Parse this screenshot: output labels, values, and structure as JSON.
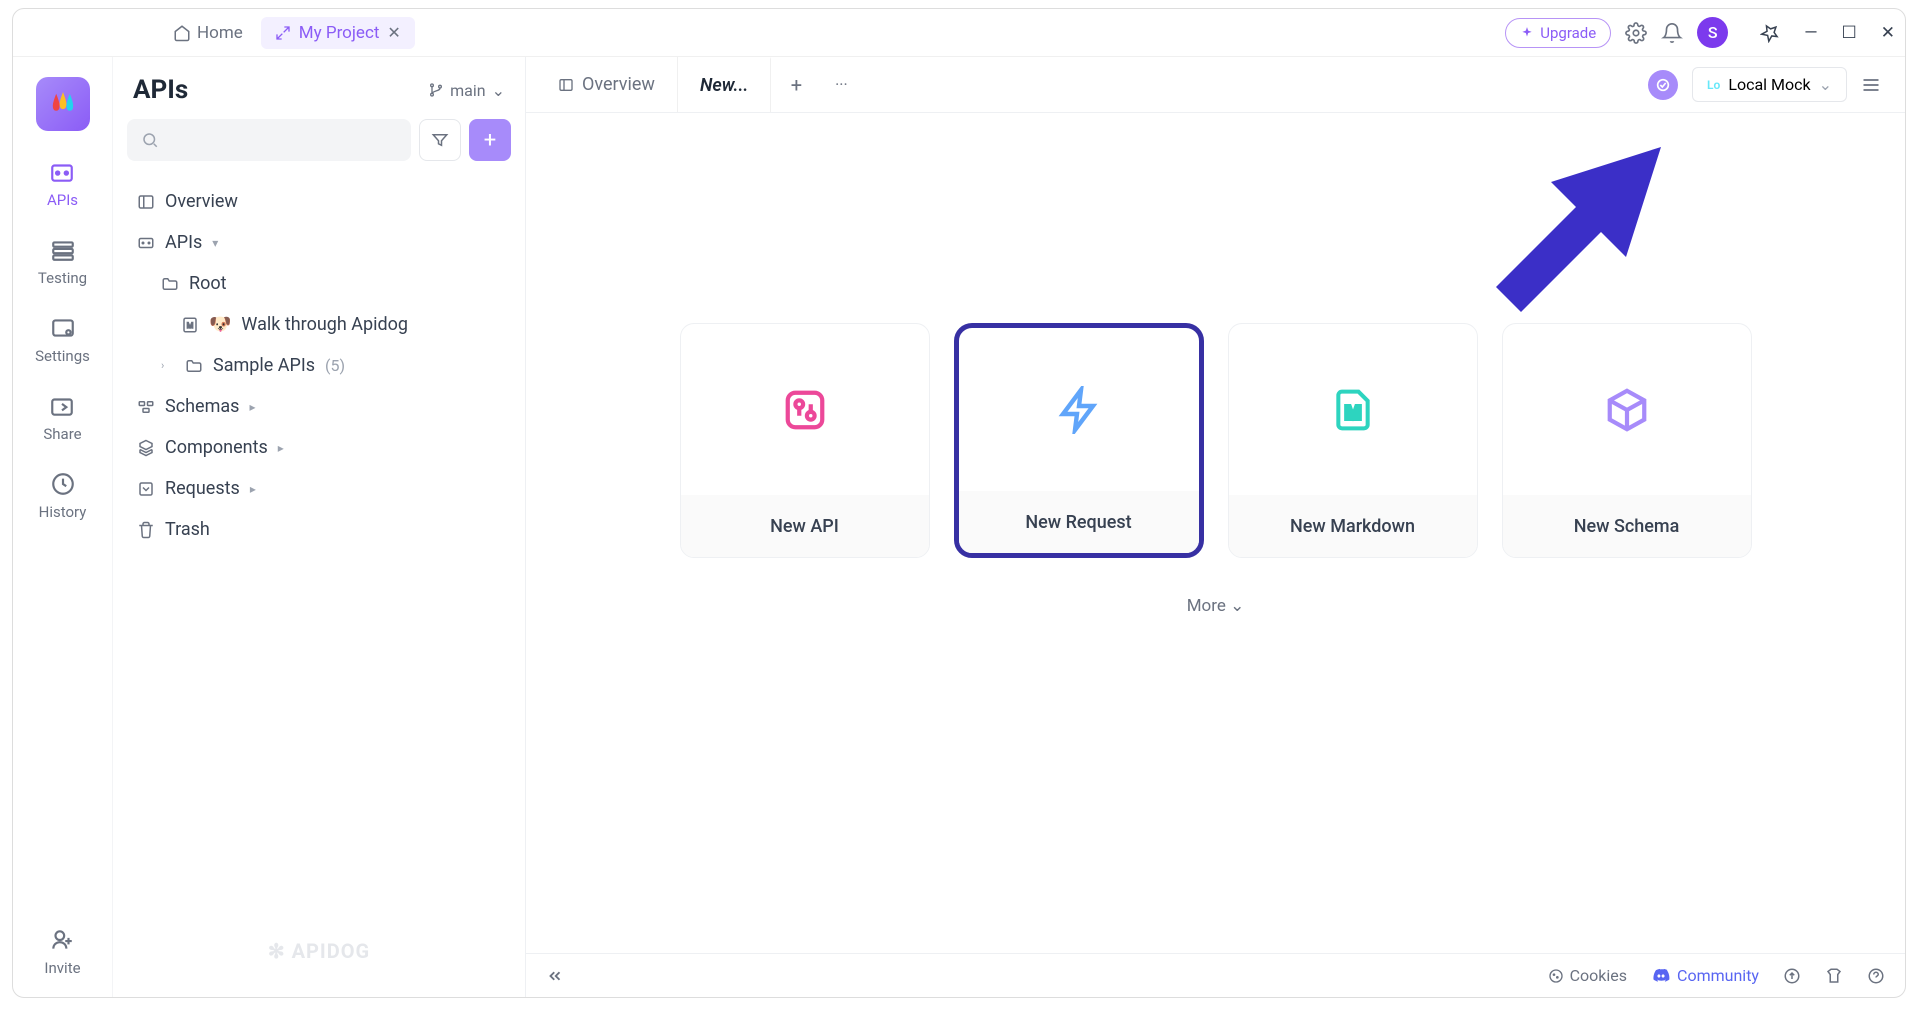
{
  "topbar": {
    "home_label": "Home",
    "project_tab_label": "My Project",
    "upgrade_label": "Upgrade",
    "avatar_initial": "S"
  },
  "far_nav": {
    "items": [
      {
        "label": "APIs"
      },
      {
        "label": "Testing"
      },
      {
        "label": "Settings"
      },
      {
        "label": "Share"
      },
      {
        "label": "History"
      }
    ],
    "invite_label": "Invite"
  },
  "sidebar": {
    "title": "APIs",
    "branch_label": "main",
    "tree": {
      "overview": "Overview",
      "apis": "APIs",
      "root": "Root",
      "walk": "Walk through Apidog",
      "sample": "Sample APIs",
      "sample_count": "(5)",
      "schemas": "Schemas",
      "components": "Components",
      "requests": "Requests",
      "trash": "Trash"
    },
    "footer_brand": "APIDOG"
  },
  "content": {
    "tabs": {
      "overview": "Overview",
      "new": "New..."
    },
    "env": {
      "lo_badge": "Lo",
      "label": "Local Mock"
    },
    "cards": [
      {
        "label": "New API"
      },
      {
        "label": "New Request"
      },
      {
        "label": "New Markdown"
      },
      {
        "label": "New Schema"
      }
    ],
    "more_label": "More"
  },
  "footer": {
    "cookies": "Cookies",
    "community": "Community"
  }
}
